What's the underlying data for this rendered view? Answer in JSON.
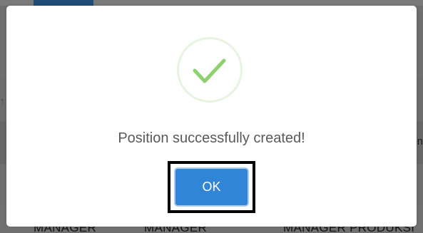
{
  "background": {
    "edge_arrow": "↑",
    "edge_text": "n",
    "roles": [
      "MANAGER",
      "MANAGER",
      "MANAGER PRODUKSI"
    ]
  },
  "dialog": {
    "icon": "checkmark-success-icon",
    "message": "Position successfully created!",
    "confirm_label": "OK"
  },
  "colors": {
    "overlay": "#6f6f6f",
    "success_check": "#8fd16f",
    "success_ring": "#e6f4e1",
    "button": "#3085d6",
    "message_text": "#595959"
  }
}
